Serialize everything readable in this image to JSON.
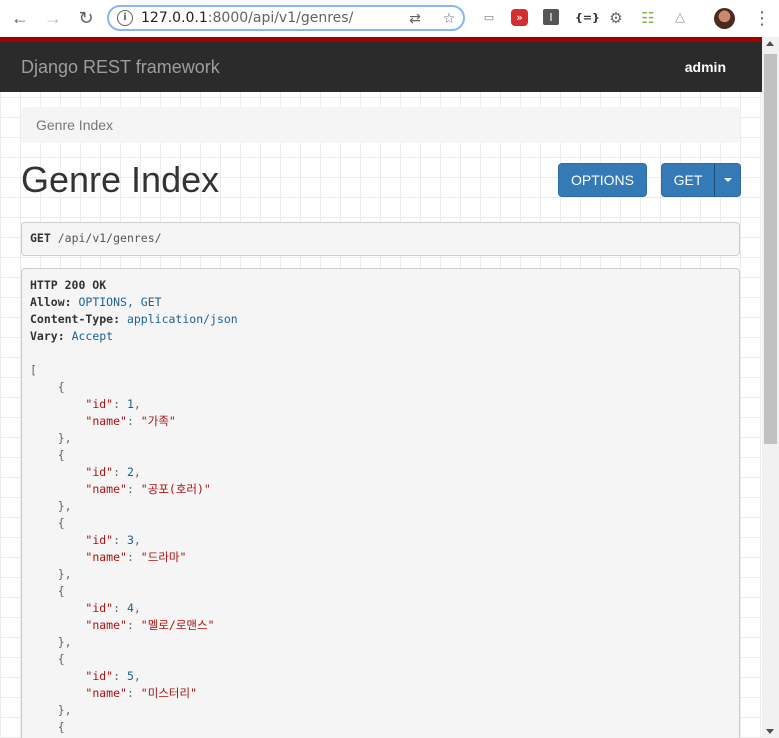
{
  "browser": {
    "url_host": "127.0.0.1",
    "url_rest": ":8000/api/v1/genres/",
    "icons": [
      "back-icon",
      "forward-icon",
      "reload-icon",
      "info-icon",
      "translate-icon",
      "star-icon",
      "menu-icon"
    ]
  },
  "navbar": {
    "brand": "Django REST framework",
    "user": "admin"
  },
  "breadcrumb": "Genre Index",
  "page_title": "Genre Index",
  "buttons": {
    "options": "OPTIONS",
    "get": "GET"
  },
  "request": {
    "method": "GET",
    "path": "/api/v1/genres/"
  },
  "response": {
    "status": "HTTP 200 OK",
    "headers": [
      {
        "name": "Allow:",
        "value": "OPTIONS, GET"
      },
      {
        "name": "Content-Type:",
        "value": "application/json"
      },
      {
        "name": "Vary:",
        "value": "Accept"
      }
    ],
    "items": [
      {
        "id": 1,
        "name": "가족"
      },
      {
        "id": 2,
        "name": "공포(호러)"
      },
      {
        "id": 3,
        "name": "드라마"
      },
      {
        "id": 4,
        "name": "멜로/로맨스"
      },
      {
        "id": 5,
        "name": "미스터리"
      }
    ]
  },
  "colors": {
    "brand_red": "#a30000",
    "navbar": "#2b2b2b",
    "button": "#337ab7"
  }
}
